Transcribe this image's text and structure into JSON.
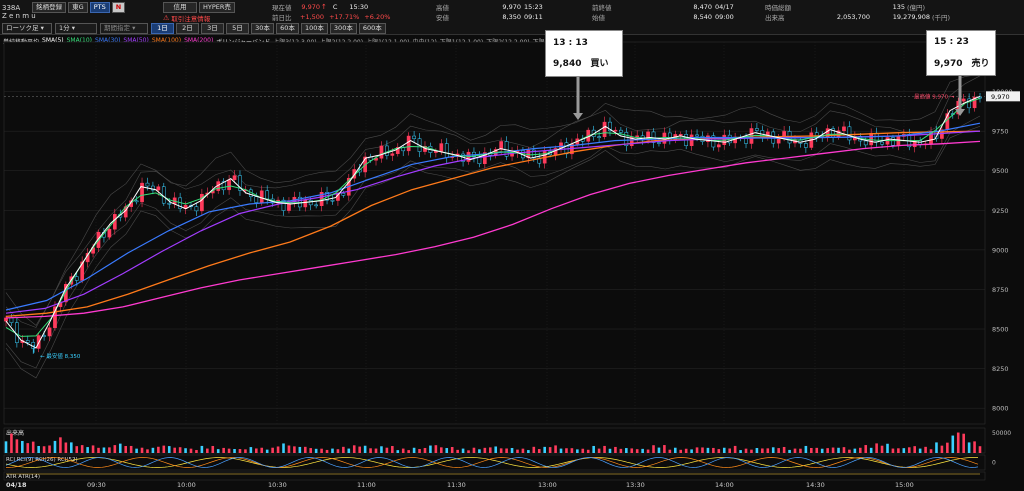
{
  "header": {
    "code": "338A",
    "buttons": [
      "銘柄登録",
      "東G",
      "PTS",
      "N"
    ],
    "name": "Z e n m u",
    "credit": "信用",
    "hyper": "HYPER売",
    "notice": "取引注意情報",
    "chart_type": "ローソク足",
    "interval": "1分",
    "period_select": "期間指定",
    "spans": [
      "1日",
      "2日",
      "3日",
      "5日",
      "30本",
      "60本",
      "100本",
      "300本",
      "600本"
    ],
    "active_span": "1日",
    "quote": {
      "price_label": "現在値",
      "price": "9,970",
      "price_mark": "↑",
      "price_flag": "C",
      "price_time": "15:30",
      "change_label": "前日比",
      "change": "+1,500",
      "change_pct": "+17.71%",
      "change_pct2": "+6.20%",
      "high_label": "高値",
      "high": "9,970",
      "high_time": "15:23",
      "low_label": "安値",
      "low": "8,350",
      "low_time": "09:11",
      "prev_label": "前終値",
      "prev": "8,470",
      "prev_date": "04/17",
      "open_label": "始値",
      "open": "8,540",
      "open_time": "09:00",
      "mcap_label": "時価総額",
      "mcap": "135",
      "mcap_unit": "(億円)",
      "volume_label": "出来高",
      "volume": "2,053,700",
      "turnover": "19,279,908",
      "turnover_unit": "(千円)"
    }
  },
  "legend": {
    "title": "単純移動平均",
    "items": [
      {
        "label": "SMA(5)",
        "color": "#ffffff"
      },
      {
        "label": "SMA(10)",
        "color": "#36e07a"
      },
      {
        "label": "SMA(30)",
        "color": "#3a7bff"
      },
      {
        "label": "SMA(50)",
        "color": "#a23cff"
      },
      {
        "label": "SMA(100)",
        "color": "#ff7a1a"
      },
      {
        "label": "SMA(200)",
        "color": "#ff3ad0"
      }
    ],
    "bollinger": "ボリンジャーバンド",
    "bands": [
      "上限3(12,3.00)",
      "上限2(12,2.00)",
      "上限1(12,1.00)",
      "中央(12)",
      "下限1(12,1.00)",
      "下限2(12,2.00)",
      "下限3(12,3.00)"
    ]
  },
  "callouts": {
    "buy": {
      "time": "13 : 13",
      "text": "9,840　買い"
    },
    "sell": {
      "time": "15 : 23",
      "text": "9,970　売り"
    }
  },
  "annotations": {
    "high": "最高値 9,970",
    "low": "最安値 8,350",
    "last_price": "9,970"
  },
  "volume_label": "出来高",
  "volume_scale": "50000",
  "rci_label": "RCI",
  "rci_items": [
    "RCI(9)",
    "RCI(26)",
    "RCI(52)"
  ],
  "rci_scale": "0",
  "atr_label": "ATR",
  "atr_item": "ATR(14)",
  "date": "04/18",
  "chart_data": {
    "type": "line",
    "ylim": [
      7900,
      10250
    ],
    "yticks": [
      8000,
      8250,
      8500,
      8750,
      9000,
      9250,
      9500,
      9750,
      10000
    ],
    "yticks_labels": [
      "8000",
      "8250",
      "8500",
      "8750",
      "9000",
      "9250",
      "9500",
      "9750",
      "10000"
    ],
    "xlabels": [
      "09:30",
      "10:00",
      "10:30",
      "11:00",
      "11:30",
      "13:00",
      "13:30",
      "14:00",
      "14:30",
      "15:00"
    ],
    "high": 9970,
    "low": 8350,
    "last": 9970,
    "buy_point": {
      "time": "13:13",
      "price": 9840
    },
    "sell_point": {
      "time": "15:23",
      "price": 9970
    },
    "price_path": [
      8550,
      8430,
      8380,
      8560,
      8760,
      8900,
      9050,
      9170,
      9250,
      9400,
      9380,
      9300,
      9260,
      9310,
      9400,
      9450,
      9360,
      9330,
      9300,
      9290,
      9300,
      9310,
      9330,
      9440,
      9580,
      9600,
      9630,
      9690,
      9640,
      9620,
      9600,
      9570,
      9600,
      9640,
      9620,
      9580,
      9600,
      9640,
      9680,
      9720,
      9780,
      9720,
      9700,
      9710,
      9700,
      9720,
      9700,
      9690,
      9680,
      9710,
      9740,
      9720,
      9700,
      9680,
      9700,
      9760,
      9730,
      9700,
      9680,
      9700,
      9690,
      9680,
      9700,
      9880,
      9930,
      9970
    ],
    "sma200": [
      8570,
      8580,
      8600,
      8640,
      8700,
      8760,
      8810,
      8850,
      8890,
      8930,
      8970,
      9020,
      9080,
      9160,
      9260,
      9350,
      9420,
      9470,
      9510,
      9550,
      9580,
      9610,
      9640,
      9660,
      9670,
      9685
    ],
    "sma100": [
      8580,
      8600,
      8640,
      8720,
      8810,
      8900,
      8980,
      9050,
      9150,
      9280,
      9380,
      9450,
      9520,
      9570,
      9620,
      9660,
      9690,
      9700,
      9710,
      9715,
      9720,
      9730,
      9740,
      9745,
      9750
    ],
    "sma50": [
      8600,
      8630,
      8720,
      8850,
      8990,
      9120,
      9230,
      9290,
      9330,
      9380,
      9460,
      9530,
      9580,
      9610,
      9630,
      9650,
      9670,
      9690,
      9700,
      9705,
      9710,
      9710,
      9715,
      9720,
      9735,
      9750
    ],
    "sma30": [
      8620,
      8680,
      8820,
      8980,
      9120,
      9240,
      9290,
      9310,
      9360,
      9450,
      9540,
      9590,
      9610,
      9640,
      9660,
      9690,
      9700,
      9710,
      9710,
      9705,
      9710,
      9712,
      9720,
      9750,
      9800
    ],
    "volume": [
      22,
      14,
      9,
      18,
      12,
      9,
      7,
      11,
      8,
      6,
      9,
      7,
      5,
      8,
      6,
      5,
      7,
      6,
      11,
      8,
      6,
      5,
      7,
      9,
      6,
      8,
      5,
      6,
      10,
      7,
      5,
      6,
      8,
      6,
      5,
      7,
      9,
      6,
      5,
      8,
      7,
      6,
      5,
      9,
      6,
      5,
      7,
      6,
      8,
      5,
      6,
      7,
      5,
      8,
      6,
      7,
      5,
      9,
      11,
      6,
      8,
      7,
      12,
      25,
      14,
      10
    ]
  }
}
